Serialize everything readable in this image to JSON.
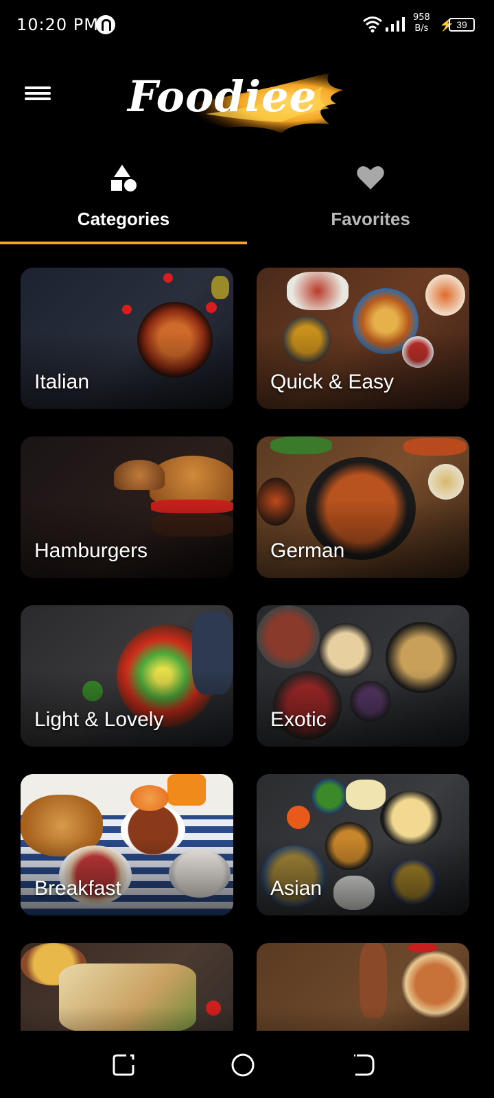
{
  "status_bar": {
    "time": "10:20 PM",
    "net_speed_value": "958",
    "net_speed_unit": "B/s",
    "battery": "39"
  },
  "app_bar": {
    "logo_text": "Foodiee"
  },
  "tabs": [
    {
      "label": "Categories",
      "icon": "shapes-icon",
      "selected": true
    },
    {
      "label": "Favorites",
      "icon": "heart-icon",
      "selected": false
    }
  ],
  "colors": {
    "accent": "#f5a623",
    "background": "#000000"
  },
  "categories": [
    {
      "label": "Italian"
    },
    {
      "label": "Quick & Easy"
    },
    {
      "label": "Hamburgers"
    },
    {
      "label": "German"
    },
    {
      "label": "Light & Lovely"
    },
    {
      "label": "Exotic"
    },
    {
      "label": "Breakfast"
    },
    {
      "label": "Asian"
    },
    {
      "label": ""
    },
    {
      "label": ""
    }
  ]
}
